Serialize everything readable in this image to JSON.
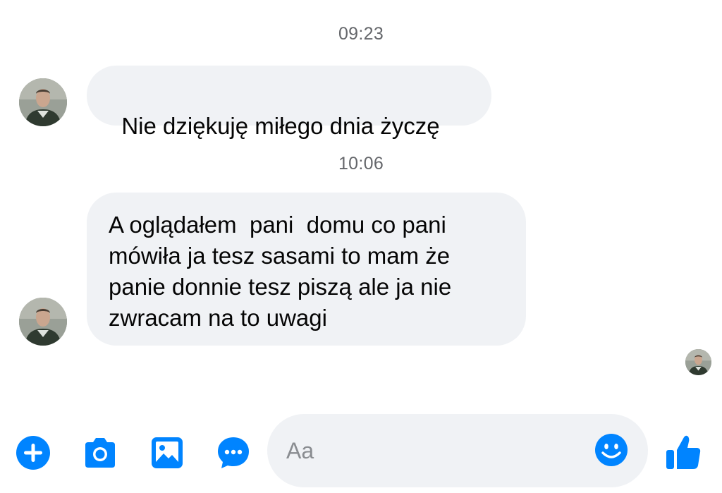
{
  "conversation": {
    "groups": [
      {
        "time": "09:23",
        "message": {
          "lines": [
            "Nie dziękuję miłego dnia życzę"
          ]
        }
      },
      {
        "time": "10:06",
        "message": {
          "lines": [
            "A oglądałem  pani  domu co pani",
            "mówiła ja tesz sasami to mam że",
            "panie donnie tesz piszą ale ja nie",
            "zwracam na to uwagi"
          ]
        }
      }
    ]
  },
  "composer": {
    "placeholder": "Aa",
    "icons": [
      "plus-icon",
      "camera-icon",
      "gallery-icon",
      "chat-bubble-icon",
      "emoji-icon",
      "thumbs-up-icon"
    ]
  },
  "theme": {
    "accent": "#0084ff",
    "bubble_bg": "#f0f2f5",
    "timestamp_color": "#65676b"
  }
}
